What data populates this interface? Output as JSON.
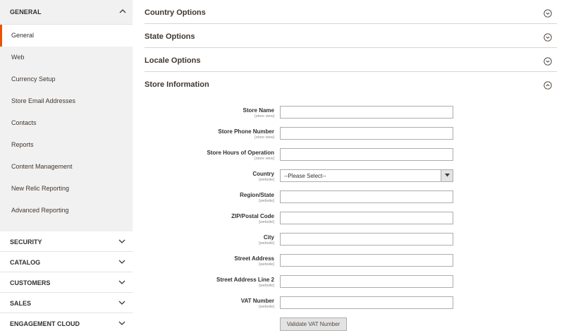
{
  "sidebar": {
    "general": {
      "title": "GENERAL",
      "items": [
        {
          "label": "General",
          "active": true
        },
        {
          "label": "Web"
        },
        {
          "label": "Currency Setup"
        },
        {
          "label": "Store Email Addresses"
        },
        {
          "label": "Contacts"
        },
        {
          "label": "Reports"
        },
        {
          "label": "Content Management"
        },
        {
          "label": "New Relic Reporting"
        },
        {
          "label": "Advanced Reporting"
        }
      ]
    },
    "sections": [
      {
        "title": "SECURITY"
      },
      {
        "title": "CATALOG"
      },
      {
        "title": "CUSTOMERS"
      },
      {
        "title": "SALES"
      },
      {
        "title": "ENGAGEMENT CLOUD"
      }
    ]
  },
  "main": {
    "sections": [
      {
        "title": "Country Options"
      },
      {
        "title": "State Options"
      },
      {
        "title": "Locale Options"
      },
      {
        "title": "Store Information"
      }
    ],
    "fields": [
      {
        "label": "Store Name",
        "scope": "[store view]",
        "value": ""
      },
      {
        "label": "Store Phone Number",
        "scope": "[store view]",
        "value": ""
      },
      {
        "label": "Store Hours of Operation",
        "scope": "[store view]",
        "value": ""
      },
      {
        "label": "Country",
        "scope": "[website]",
        "value": "--Please Select--"
      },
      {
        "label": "Region/State",
        "scope": "[website]",
        "value": ""
      },
      {
        "label": "ZIP/Postal Code",
        "scope": "[website]",
        "value": ""
      },
      {
        "label": "City",
        "scope": "[website]",
        "value": ""
      },
      {
        "label": "Street Address",
        "scope": "[website]",
        "value": ""
      },
      {
        "label": "Street Address Line 2",
        "scope": "[website]",
        "value": ""
      },
      {
        "label": "VAT Number",
        "scope": "[website]",
        "value": ""
      }
    ],
    "validate_vat_label": "Validate VAT Number"
  },
  "colors": {
    "accent": "#eb5202",
    "sidebar_bg": "#f1f1f1"
  }
}
